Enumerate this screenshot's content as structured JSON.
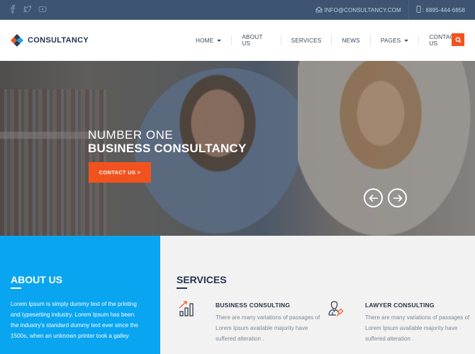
{
  "topbar": {
    "social": [
      {
        "name": "facebook-icon",
        "glyph": "f"
      },
      {
        "name": "twitter-icon",
        "glyph": "t"
      },
      {
        "name": "youtube-icon",
        "glyph": "▶"
      }
    ],
    "email": "INFO@CONSULTANCY.COM",
    "phone": ": 8895-444-6858"
  },
  "header": {
    "logo_text": "CONSULTANCY",
    "nav": [
      {
        "label": "HOME",
        "dropdown": true
      },
      {
        "label": "ABOUT US",
        "dropdown": false
      },
      {
        "label": "SERVICES",
        "dropdown": false
      },
      {
        "label": "NEWS",
        "dropdown": false
      },
      {
        "label": "PAGES",
        "dropdown": true
      },
      {
        "label": "CONTACT US",
        "dropdown": false
      }
    ],
    "search_icon": "search-icon"
  },
  "hero": {
    "subtitle": "NUMBER ONE",
    "title": "BUSINESS CONSULTANCY",
    "cta": "CONTACT US >"
  },
  "about": {
    "title": "ABOUT US",
    "text": "Lorem Ipsum is simply dummy text of the printing and typesetting industry. Lorem Ipsum has been the industry's standard dummy text ever since the 1500s, when an unknown printer took a galley"
  },
  "services": {
    "title": "SERVICES",
    "items": [
      {
        "title": "BUSINESS CONSULTING",
        "text": "There are many variations of passages of Lorem Ipsum available majority have suffered alteration ."
      },
      {
        "title": "LAWYER CONSULTING",
        "text": "There are many variations of passages of Lorem Ipsum available majority have suffered alteration ."
      }
    ]
  },
  "colors": {
    "accent": "#f2531e",
    "about_bg": "#0aa5f0",
    "topbar_bg": "#3d5573",
    "navy": "#1f3450"
  }
}
